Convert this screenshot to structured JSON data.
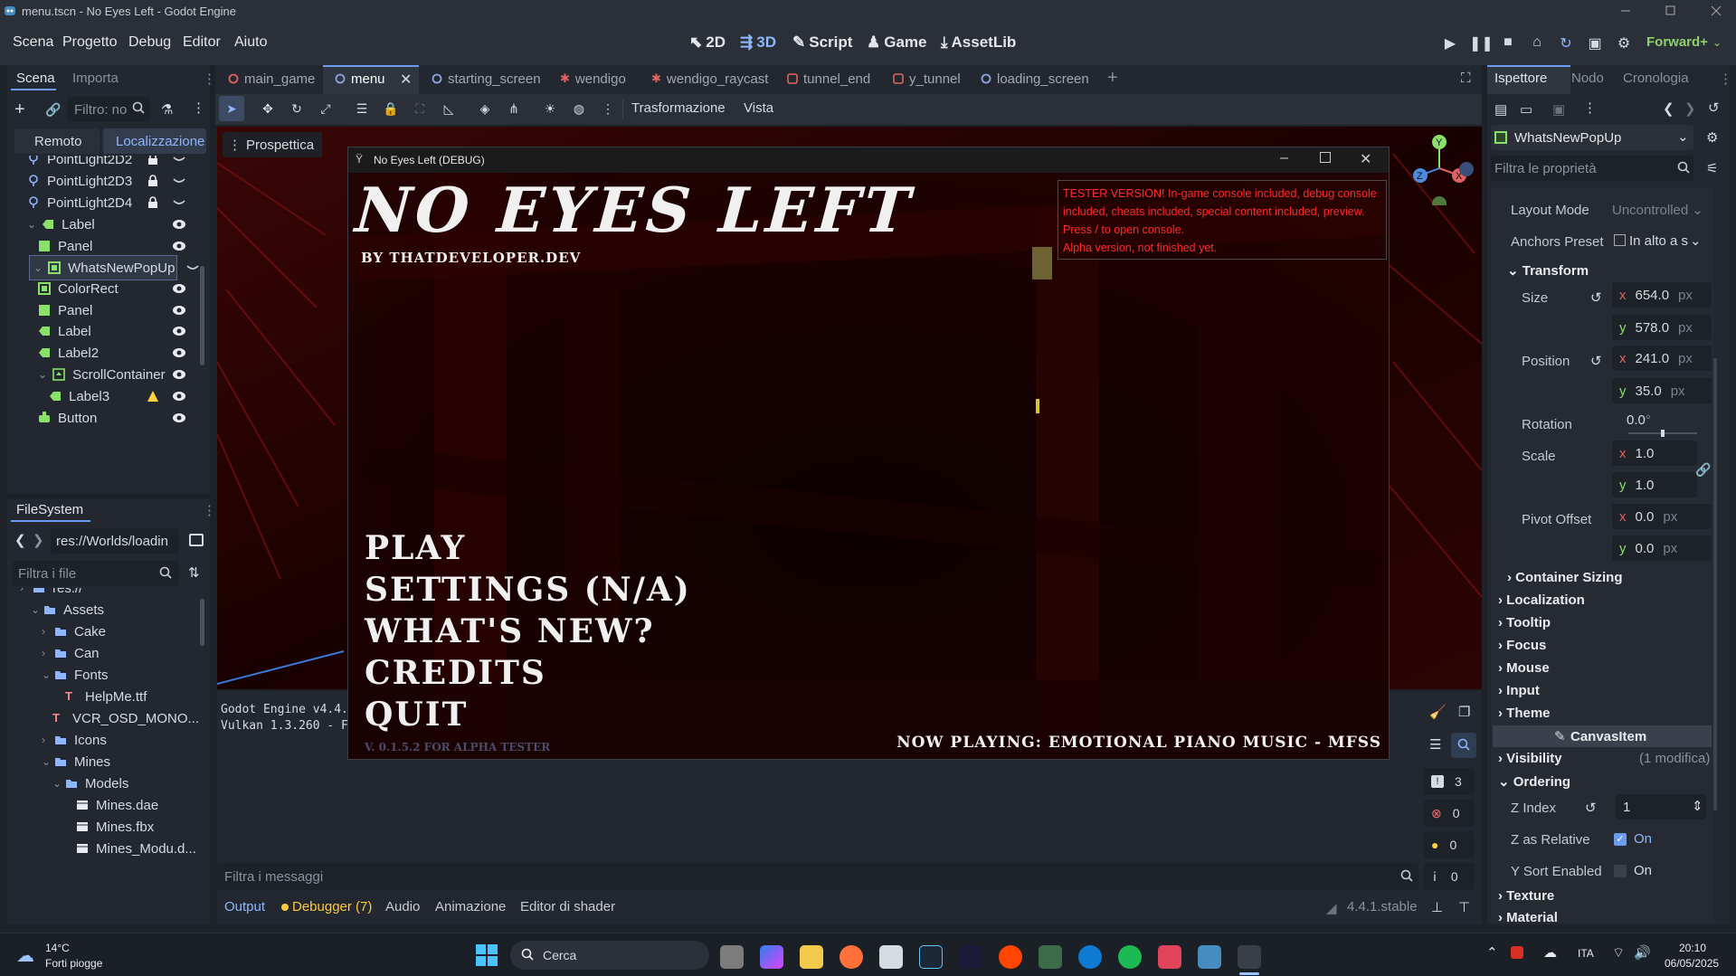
{
  "window": {
    "title": "menu.tscn - No Eyes Left - Godot Engine"
  },
  "menu": {
    "items": [
      "Scena",
      "Progetto",
      "Debug",
      "Editor",
      "Aiuto"
    ]
  },
  "workspaces": {
    "w2d": "2D",
    "w3d": "3D",
    "script": "Script",
    "game": "Game",
    "assetlib": "AssetLib"
  },
  "renderer": "Forward+",
  "scene_dock": {
    "tabs": [
      "Scena",
      "Importa"
    ],
    "filter_placeholder": "Filtro: no",
    "remote": "Remoto",
    "local": "Localizzazione",
    "nodes": [
      {
        "label": "PointLight2D2",
        "icon": "pointlight-icon",
        "depth": 1
      },
      {
        "label": "PointLight2D3",
        "icon": "pointlight-icon",
        "depth": 1
      },
      {
        "label": "PointLight2D4",
        "icon": "pointlight-icon",
        "depth": 1
      },
      {
        "label": "Label",
        "icon": "label-icon",
        "depth": 1
      },
      {
        "label": "Panel",
        "icon": "panel-icon",
        "depth": 2
      },
      {
        "label": "WhatsNewPopUp",
        "icon": "colorrect-icon",
        "depth": 1
      },
      {
        "label": "ColorRect",
        "icon": "colorrect-icon",
        "depth": 2
      },
      {
        "label": "Panel",
        "icon": "panel-icon",
        "depth": 2
      },
      {
        "label": "Label",
        "icon": "label-icon",
        "depth": 2
      },
      {
        "label": "Label2",
        "icon": "label-icon",
        "depth": 2
      },
      {
        "label": "ScrollContainer",
        "icon": "scroll-icon",
        "depth": 2
      },
      {
        "label": "Label3",
        "icon": "label-icon",
        "depth": 3
      },
      {
        "label": "Button",
        "icon": "button-icon",
        "depth": 2
      }
    ]
  },
  "filesystem": {
    "tab": "FileSystem",
    "path": "res://Worlds/loadin",
    "filter_placeholder": "Filtra i file",
    "items": [
      {
        "label": "res://",
        "type": "folder",
        "depth": 0
      },
      {
        "label": "Assets",
        "type": "folder",
        "depth": 1
      },
      {
        "label": "Cake",
        "type": "folder",
        "depth": 2
      },
      {
        "label": "Can",
        "type": "folder",
        "depth": 2
      },
      {
        "label": "Fonts",
        "type": "folder",
        "depth": 2
      },
      {
        "label": "HelpMe.ttf",
        "type": "font",
        "depth": 3
      },
      {
        "label": "VCR_OSD_MONO...",
        "type": "font",
        "depth": 3
      },
      {
        "label": "Icons",
        "type": "folder",
        "depth": 2
      },
      {
        "label": "Mines",
        "type": "folder",
        "depth": 2
      },
      {
        "label": "Models",
        "type": "folder",
        "depth": 3
      },
      {
        "label": "Mines.dae",
        "type": "scene",
        "depth": 4
      },
      {
        "label": "Mines.fbx",
        "type": "scene",
        "depth": 4
      },
      {
        "label": "Mines_Modu.d...",
        "type": "scene",
        "depth": 4
      }
    ]
  },
  "editor_tabs": [
    {
      "label": "main_game",
      "icon": "node-icon",
      "color": "#e06262"
    },
    {
      "label": "menu",
      "icon": "node-icon",
      "color": "#8fa5e0"
    },
    {
      "label": "starting_screen",
      "icon": "node-icon",
      "color": "#8fa5e0"
    },
    {
      "label": "wendigo",
      "icon": "character-icon",
      "color": "#e06262"
    },
    {
      "label": "wendigo_raycast",
      "icon": "character-icon",
      "color": "#e06262"
    },
    {
      "label": "tunnel_end",
      "icon": "mesh-icon",
      "color": "#e06262"
    },
    {
      "label": "y_tunnel",
      "icon": "mesh-icon",
      "color": "#e06262"
    },
    {
      "label": "loading_screen",
      "icon": "node-icon",
      "color": "#8fa5e0"
    }
  ],
  "toolbar": {
    "transform": "Trasformazione",
    "view": "Vista",
    "perspective": "Prospettica"
  },
  "game_window": {
    "title": "No Eyes Left (DEBUG)",
    "game_title": "NO EYES LEFT",
    "byline": "BY THATDEVELOPER.DEV",
    "notice": [
      "TESTER VERSION! In-game console included, debug console included, cheats included, special content included, preview.",
      "Press / to open console.",
      "Alpha version, not finished yet."
    ],
    "menu": [
      "PLAY",
      "SETTINGS (N/A)",
      "WHAT'S NEW?",
      "CREDITS",
      "QUIT"
    ],
    "version": "V. 0.1.5.2 FOR ALPHA TESTER",
    "now_playing": "NOW PLAYING: EMOTIONAL PIANO MUSIC - MFSS"
  },
  "output": {
    "line1": "Godot Engine v4.4.",
    "line2": "Vulkan 1.3.260 - F",
    "filter_placeholder": "Filtra i messaggi",
    "counts": [
      "3",
      "0",
      "0",
      "0"
    ]
  },
  "bottom_tabs": {
    "output": "Output",
    "debugger": "Debugger (7)",
    "audio": "Audio",
    "animation": "Animazione",
    "shader": "Editor di shader",
    "version": "4.4.1.stable"
  },
  "inspector": {
    "tabs": [
      "Ispettore",
      "Nodo",
      "Cronologia"
    ],
    "node": "WhatsNewPopUp",
    "filter_placeholder": "Filtra le proprietà",
    "layout_mode": {
      "label": "Layout Mode",
      "value": "Uncontrolled"
    },
    "anchors": {
      "label": "Anchors Preset",
      "value": "In alto a s"
    },
    "transform": "Transform",
    "size": {
      "label": "Size",
      "x": "654.0",
      "y": "578.0",
      "unit": "px"
    },
    "position": {
      "label": "Position",
      "x": "241.0",
      "y": "35.0",
      "unit": "px"
    },
    "rotation": {
      "label": "Rotation",
      "value": "0.0",
      "unit": "°",
      "fraction": 0.0
    },
    "scale": {
      "label": "Scale",
      "x": "1.0",
      "y": "1.0"
    },
    "pivot": {
      "label": "Pivot Offset",
      "x": "0.0",
      "y": "0.0",
      "unit": "px"
    },
    "sections": [
      "Container Sizing",
      "Localization",
      "Tooltip",
      "Focus",
      "Mouse",
      "Input",
      "Theme"
    ],
    "canvas_item": "CanvasItem",
    "visibility": {
      "label": "Visibility",
      "note": "(1 modifica)"
    },
    "ordering": "Ordering",
    "z_index": {
      "label": "Z Index",
      "value": "1"
    },
    "z_relative": {
      "label": "Z as Relative",
      "value": "On",
      "checked": true
    },
    "y_sort": {
      "label": "Y Sort Enabled",
      "value": "On",
      "checked": false
    },
    "texture": "Texture",
    "material": "Material"
  },
  "taskbar": {
    "temp": "14°C",
    "weather": "Forti piogge",
    "search": "Cerca",
    "lang": "ITA",
    "time": "20:10",
    "date": "06/05/2025"
  }
}
